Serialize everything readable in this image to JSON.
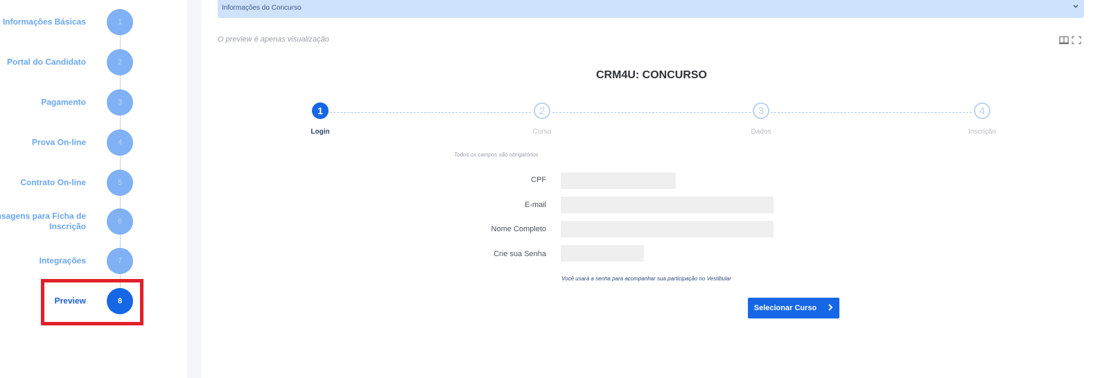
{
  "sidebar": {
    "steps": [
      {
        "label": "Informações Básicas",
        "number": "1"
      },
      {
        "label": "Portal do Candidato",
        "number": "2"
      },
      {
        "label": "Pagamento",
        "number": "3"
      },
      {
        "label": "Prova On-line",
        "number": "4"
      },
      {
        "label": "Contrato On-line",
        "number": "5"
      },
      {
        "label": "Mensagens para Ficha de Inscrição",
        "number": "6"
      },
      {
        "label": "Integrações",
        "number": "7"
      },
      {
        "label": "Preview",
        "number": "8"
      }
    ],
    "active_step": "8"
  },
  "accordion": {
    "title": "Informações do Concurso",
    "icon": "chevron-down-icon"
  },
  "preview": {
    "note": "O preview é apenas visualização",
    "tools": [
      "split-view-icon",
      "fullscreen-icon"
    ]
  },
  "form": {
    "title": "CRM4U: CONCURSO",
    "wizard": [
      {
        "number": "1",
        "label": "Login",
        "active": true
      },
      {
        "number": "2",
        "label": "Curso",
        "active": false
      },
      {
        "number": "3",
        "label": "Dados",
        "active": false
      },
      {
        "number": "4",
        "label": "Inscrição",
        "active": false
      }
    ],
    "required_note": "Todos os campos são obrigatórios",
    "fields": {
      "cpf": {
        "label": "CPF",
        "value": ""
      },
      "email": {
        "label": "E-mail",
        "value": ""
      },
      "nome": {
        "label": "Nome Completo",
        "value": ""
      },
      "senha": {
        "label": "Crie sua Senha",
        "value": ""
      }
    },
    "hint": "Você usará a senha para acompanhar sua participação no Vestibular",
    "next_button": {
      "label": "Selecionar Curso",
      "icon": "chevron-right-icon"
    }
  },
  "colors": {
    "primary": "#1567e6",
    "step_inactive": "#7fb1f4",
    "highlight": "#e1202a",
    "accordion_bg": "#cfe2fc"
  }
}
